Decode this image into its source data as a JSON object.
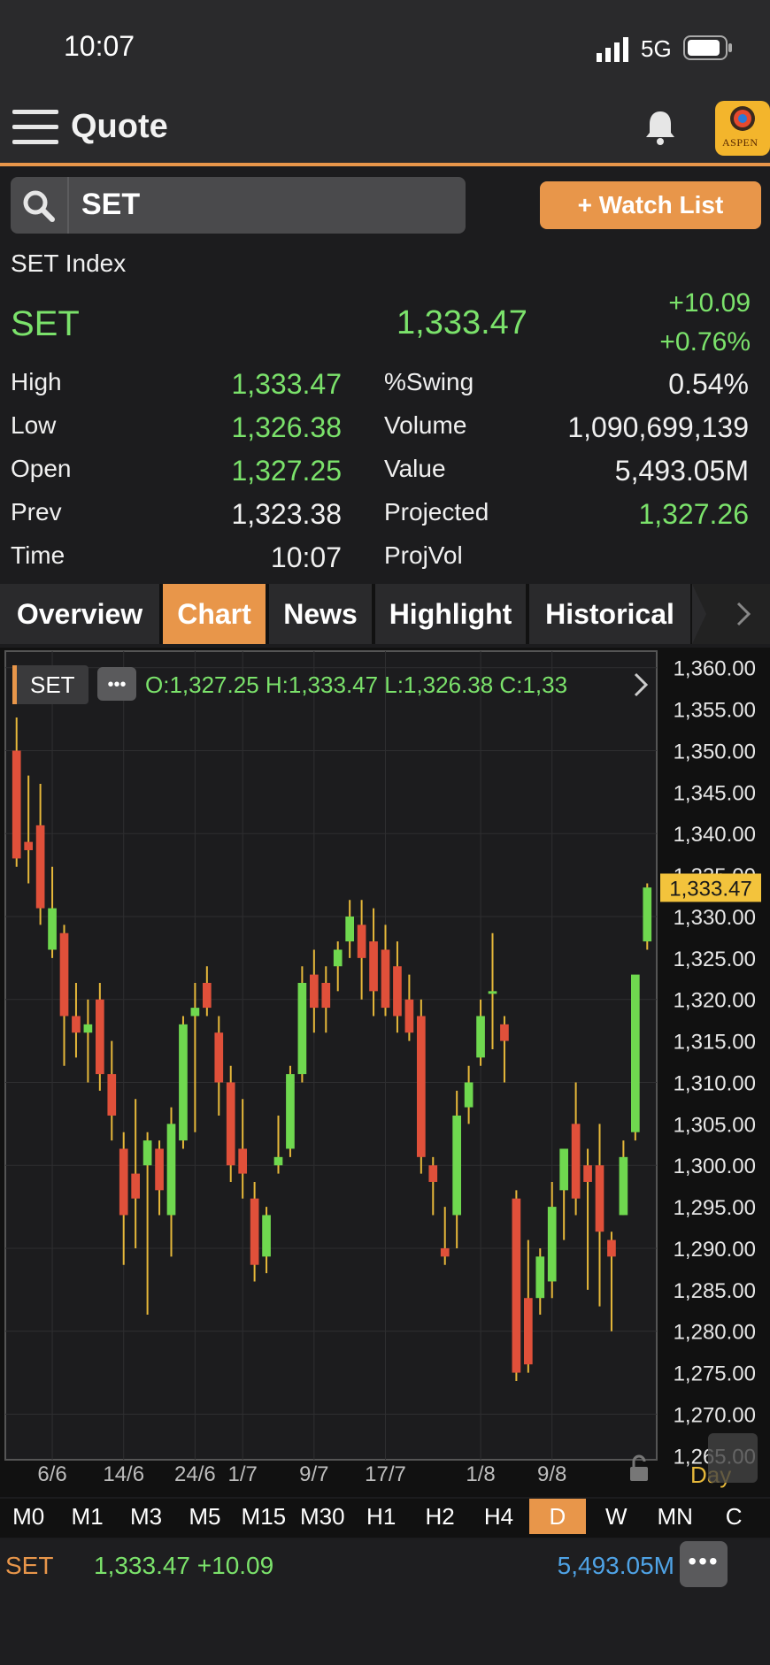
{
  "status_bar": {
    "time": "10:07",
    "network": "5G"
  },
  "header": {
    "title": "Quote"
  },
  "search": {
    "value": "SET"
  },
  "watchlist": {
    "label": "+ Watch List"
  },
  "quote": {
    "index_name": "SET Index",
    "symbol": "SET",
    "last": "1,333.47",
    "change": "+10.09",
    "change_pct": "+0.76%",
    "stats": [
      {
        "label": "High",
        "value": "1,333.47",
        "color": "green",
        "label2": "%Swing",
        "value2": "0.54%",
        "color2": "white"
      },
      {
        "label": "Low",
        "value": "1,326.38",
        "color": "green",
        "label2": "Volume",
        "value2": "1,090,699,139",
        "color2": "white"
      },
      {
        "label": "Open",
        "value": "1,327.25",
        "color": "green",
        "label2": "Value",
        "value2": "5,493.05M",
        "color2": "white"
      },
      {
        "label": "Prev",
        "value": "1,323.38",
        "color": "white",
        "label2": "Projected",
        "value2": "1,327.26",
        "color2": "green"
      },
      {
        "label": "Time",
        "value": "10:07",
        "color": "white",
        "label2": "ProjVol",
        "value2": "",
        "color2": "white"
      }
    ]
  },
  "tabs": [
    "Overview",
    "Chart",
    "News",
    "Highlight",
    "Historical"
  ],
  "active_tab": "Chart",
  "chart_data": {
    "type": "candlestick",
    "symbol": "SET",
    "ohlc_label": "O:1,327.25  H:1,333.47  L:1,326.38  C:1,33",
    "ylim": [
      1265,
      1362
    ],
    "y_ticks": [
      1265,
      1270,
      1275,
      1280,
      1285,
      1290,
      1295,
      1300,
      1305,
      1310,
      1315,
      1320,
      1325,
      1330,
      1335,
      1340,
      1345,
      1350,
      1355,
      1360
    ],
    "y_tick_labels": [
      "1,265.00",
      "1,270.00",
      "1,275.00",
      "1,280.00",
      "1,285.00",
      "1,290.00",
      "1,295.00",
      "1,300.00",
      "1,305.00",
      "1,310.00",
      "1,315.00",
      "1,320.00",
      "1,325.00",
      "1,330.00",
      "1,335.00",
      "1,340.00",
      "1,345.00",
      "1,350.00",
      "1,355.00",
      "1,360.00"
    ],
    "last_price_label": "1,333.47",
    "last_price": 1333.47,
    "x_labels": [
      {
        "label": "6/6",
        "index": 3
      },
      {
        "label": "14/6",
        "index": 9
      },
      {
        "label": "24/6",
        "index": 15
      },
      {
        "label": "1/7",
        "index": 19
      },
      {
        "label": "9/7",
        "index": 25
      },
      {
        "label": "17/7",
        "index": 31
      },
      {
        "label": "1/8",
        "index": 39
      },
      {
        "label": "9/8",
        "index": 45
      }
    ],
    "period_label": "Day",
    "candles": [
      {
        "o": 1350,
        "h": 1354,
        "l": 1336,
        "c": 1337
      },
      {
        "o": 1339,
        "h": 1347,
        "l": 1334,
        "c": 1338
      },
      {
        "o": 1341,
        "h": 1346,
        "l": 1329,
        "c": 1331
      },
      {
        "o": 1326,
        "h": 1336,
        "l": 1325,
        "c": 1331
      },
      {
        "o": 1328,
        "h": 1329,
        "l": 1312,
        "c": 1318
      },
      {
        "o": 1318,
        "h": 1322,
        "l": 1313,
        "c": 1316
      },
      {
        "o": 1316,
        "h": 1320,
        "l": 1310,
        "c": 1317
      },
      {
        "o": 1320,
        "h": 1322,
        "l": 1309,
        "c": 1311
      },
      {
        "o": 1311,
        "h": 1315,
        "l": 1303,
        "c": 1306
      },
      {
        "o": 1302,
        "h": 1304,
        "l": 1288,
        "c": 1294
      },
      {
        "o": 1299,
        "h": 1308,
        "l": 1290,
        "c": 1296
      },
      {
        "o": 1300,
        "h": 1304,
        "l": 1282,
        "c": 1303
      },
      {
        "o": 1302,
        "h": 1303,
        "l": 1294,
        "c": 1297
      },
      {
        "o": 1294,
        "h": 1307,
        "l": 1289,
        "c": 1305
      },
      {
        "o": 1303,
        "h": 1318,
        "l": 1302,
        "c": 1317
      },
      {
        "o": 1318,
        "h": 1322,
        "l": 1304,
        "c": 1319
      },
      {
        "o": 1322,
        "h": 1324,
        "l": 1318,
        "c": 1319
      },
      {
        "o": 1316,
        "h": 1318,
        "l": 1306,
        "c": 1310
      },
      {
        "o": 1310,
        "h": 1312,
        "l": 1298,
        "c": 1300
      },
      {
        "o": 1302,
        "h": 1308,
        "l": 1296,
        "c": 1299
      },
      {
        "o": 1296,
        "h": 1298,
        "l": 1286,
        "c": 1288
      },
      {
        "o": 1289,
        "h": 1295,
        "l": 1287,
        "c": 1294
      },
      {
        "o": 1300,
        "h": 1306,
        "l": 1299,
        "c": 1301
      },
      {
        "o": 1302,
        "h": 1312,
        "l": 1301,
        "c": 1311
      },
      {
        "o": 1311,
        "h": 1324,
        "l": 1310,
        "c": 1322
      },
      {
        "o": 1323,
        "h": 1326,
        "l": 1316,
        "c": 1319
      },
      {
        "o": 1322,
        "h": 1324,
        "l": 1316,
        "c": 1319
      },
      {
        "o": 1324,
        "h": 1327,
        "l": 1321,
        "c": 1326
      },
      {
        "o": 1327,
        "h": 1332,
        "l": 1325,
        "c": 1330
      },
      {
        "o": 1329,
        "h": 1332,
        "l": 1320,
        "c": 1325
      },
      {
        "o": 1327,
        "h": 1331,
        "l": 1318,
        "c": 1321
      },
      {
        "o": 1326,
        "h": 1329,
        "l": 1318,
        "c": 1319
      },
      {
        "o": 1324,
        "h": 1327,
        "l": 1316,
        "c": 1318
      },
      {
        "o": 1320,
        "h": 1323,
        "l": 1315,
        "c": 1316
      },
      {
        "o": 1318,
        "h": 1320,
        "l": 1299,
        "c": 1301
      },
      {
        "o": 1300,
        "h": 1301,
        "l": 1294,
        "c": 1298
      },
      {
        "o": 1290,
        "h": 1295,
        "l": 1288,
        "c": 1289
      },
      {
        "o": 1294,
        "h": 1309,
        "l": 1290,
        "c": 1306
      },
      {
        "o": 1307,
        "h": 1312,
        "l": 1305,
        "c": 1310
      },
      {
        "o": 1313,
        "h": 1320,
        "l": 1312,
        "c": 1318
      },
      {
        "o": 1321,
        "h": 1328,
        "l": 1314,
        "c": 1321
      },
      {
        "o": 1317,
        "h": 1318,
        "l": 1310,
        "c": 1315
      },
      {
        "o": 1296,
        "h": 1297,
        "l": 1274,
        "c": 1275
      },
      {
        "o": 1284,
        "h": 1291,
        "l": 1275,
        "c": 1276
      },
      {
        "o": 1284,
        "h": 1290,
        "l": 1282,
        "c": 1289
      },
      {
        "o": 1286,
        "h": 1298,
        "l": 1284,
        "c": 1295
      },
      {
        "o": 1297,
        "h": 1301,
        "l": 1291,
        "c": 1302
      },
      {
        "o": 1305,
        "h": 1310,
        "l": 1294,
        "c": 1296
      },
      {
        "o": 1300,
        "h": 1302,
        "l": 1285,
        "c": 1298
      },
      {
        "o": 1300,
        "h": 1305,
        "l": 1283,
        "c": 1292
      },
      {
        "o": 1291,
        "h": 1292,
        "l": 1280,
        "c": 1289
      },
      {
        "o": 1294,
        "h": 1303,
        "l": 1294,
        "c": 1301
      },
      {
        "o": 1304,
        "h": 1322,
        "l": 1303,
        "c": 1323
      },
      {
        "o": 1327,
        "h": 1334,
        "l": 1326,
        "c": 1333.5
      }
    ]
  },
  "timeframes": [
    "M0",
    "M1",
    "M3",
    "M5",
    "M15",
    "M30",
    "H1",
    "H2",
    "H4",
    "D",
    "W",
    "MN",
    "C"
  ],
  "active_timeframe": "D",
  "bottom_bar": {
    "symbol": "SET",
    "price": "1,333.47 +10.09",
    "value": "5,493.05M"
  },
  "colors": {
    "up": "#6fd84f",
    "down": "#e0503a",
    "accent": "#e8964a",
    "positive_text": "#7be26b"
  }
}
